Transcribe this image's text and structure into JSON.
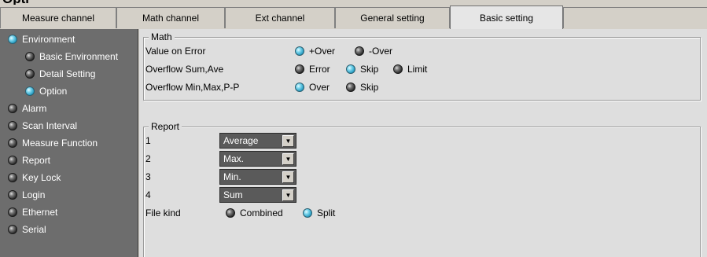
{
  "tabs": [
    {
      "label": "Measure channel"
    },
    {
      "label": "Math channel"
    },
    {
      "label": "Ext channel"
    },
    {
      "label": "General setting"
    },
    {
      "label": "Basic setting"
    }
  ],
  "sidebar": {
    "items": [
      {
        "label": "Environment",
        "state": "on"
      },
      {
        "label": "Basic Environment",
        "state": "off"
      },
      {
        "label": "Detail Setting",
        "state": "off"
      },
      {
        "label": "Option",
        "state": "on"
      },
      {
        "label": "Alarm",
        "state": "off"
      },
      {
        "label": "Scan Interval",
        "state": "off"
      },
      {
        "label": "Measure Function",
        "state": "off"
      },
      {
        "label": "Report",
        "state": "off"
      },
      {
        "label": "Key Lock",
        "state": "off"
      },
      {
        "label": "Login",
        "state": "off"
      },
      {
        "label": "Ethernet",
        "state": "off"
      },
      {
        "label": "Serial",
        "state": "off"
      }
    ]
  },
  "math": {
    "title": "Math",
    "rows": [
      {
        "label": "Value on Error",
        "options": [
          {
            "label": "+Over",
            "selected": true
          },
          {
            "label": "-Over",
            "selected": false
          }
        ]
      },
      {
        "label": "Overflow Sum,Ave",
        "options": [
          {
            "label": "Error",
            "selected": false
          },
          {
            "label": "Skip",
            "selected": true
          },
          {
            "label": "Limit",
            "selected": false
          }
        ]
      },
      {
        "label": "Overflow Min,Max,P-P",
        "options": [
          {
            "label": "Over",
            "selected": true
          },
          {
            "label": "Skip",
            "selected": false
          }
        ]
      }
    ]
  },
  "report": {
    "title": "Report",
    "items": [
      {
        "num": "1",
        "value": "Average"
      },
      {
        "num": "2",
        "value": "Max."
      },
      {
        "num": "3",
        "value": "Min."
      },
      {
        "num": "4",
        "value": "Sum"
      }
    ],
    "file_kind": {
      "label": "File kind",
      "options": [
        {
          "label": "Combined",
          "selected": false
        },
        {
          "label": "Split",
          "selected": true
        }
      ]
    }
  },
  "dropdown_arrow": "▼",
  "colors": {
    "led_on": "#2a9fc4",
    "led_off": "#2f2f2f",
    "sidebar_bg": "#6d6d6d",
    "panel_bg": "#dedede",
    "select_bg": "#5a5a5a"
  }
}
